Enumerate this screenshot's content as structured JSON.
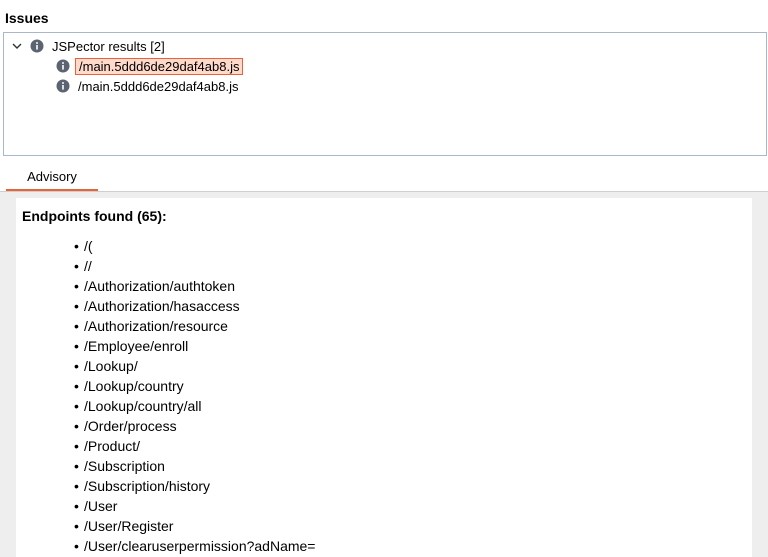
{
  "issues": {
    "title": "Issues",
    "root_label": "JSPector results [2]",
    "children": [
      {
        "label": "/main.5ddd6de29daf4ab8.js",
        "selected": true
      },
      {
        "label": "/main.5ddd6de29daf4ab8.js",
        "selected": false
      }
    ]
  },
  "tabs": {
    "advisory_label": "Advisory"
  },
  "advisory": {
    "heading": "Endpoints found (65):",
    "bullet": "•",
    "endpoints": [
      "/(",
      "//",
      "/Authorization/authtoken",
      "/Authorization/hasaccess",
      "/Authorization/resource",
      "/Employee/enroll",
      "/Lookup/",
      "/Lookup/country",
      "/Lookup/country/all",
      "/Order/process",
      "/Product/",
      "/Subscription",
      "/Subscription/history",
      "/User",
      "/User/Register",
      "/User/clearuserpermission?adName="
    ]
  },
  "colors": {
    "accent": "#e8623a",
    "selection_bg": "#ffd9c9",
    "info_icon": "#5b6470",
    "panel_border": "#a9b8c9"
  },
  "icons": {
    "expand": "chevron-down-icon",
    "info": "info-icon"
  }
}
